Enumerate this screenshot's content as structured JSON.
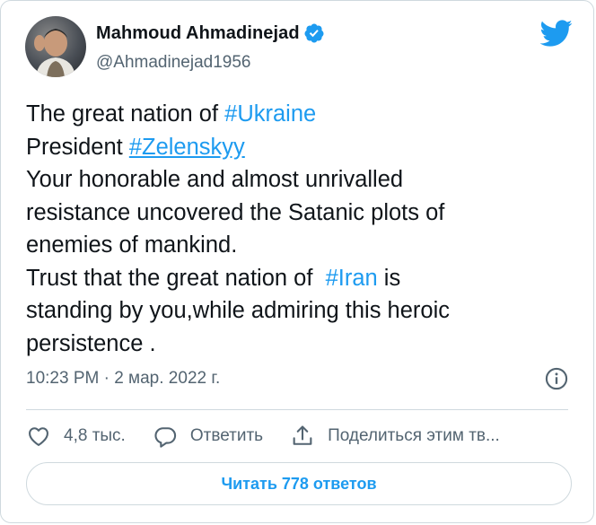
{
  "author": {
    "display_name": "Mahmoud Ahmadinejad",
    "handle": "@Ahmadinejad1956",
    "verified": true
  },
  "tweet": {
    "lines": [
      [
        {
          "t": "The great nation of "
        },
        {
          "t": "#Ukraine",
          "tag": true
        }
      ],
      [
        {
          "t": "President "
        },
        {
          "t": "#Zelenskyy",
          "tag": true,
          "underline": true
        }
      ],
      [
        {
          "t": "Your honorable and almost unrivalled"
        }
      ],
      [
        {
          "t": "resistance uncovered the Satanic plots of"
        }
      ],
      [
        {
          "t": "enemies of mankind."
        }
      ],
      [
        {
          "t": "Trust that the great nation of  "
        },
        {
          "t": "#Iran",
          "tag": true
        },
        {
          "t": " is"
        }
      ],
      [
        {
          "t": "standing by you,while admiring this heroic"
        }
      ],
      [
        {
          "t": "persistence ."
        }
      ]
    ]
  },
  "meta": {
    "timestamp": "10:23 PM · 2 мар. 2022 г."
  },
  "actions": {
    "like_count": "4,8 тыс.",
    "reply_label": "Ответить",
    "share_label": "Поделиться этим тв..."
  },
  "read_replies": {
    "label": "Читать 778 ответов"
  },
  "colors": {
    "accent": "#1d9bf0",
    "text": "#0f1419",
    "secondary": "#536471",
    "border": "#cfd9de"
  },
  "icons": [
    "twitter-bird-icon",
    "verified-badge-icon",
    "info-icon",
    "heart-icon",
    "reply-icon",
    "share-icon"
  ]
}
